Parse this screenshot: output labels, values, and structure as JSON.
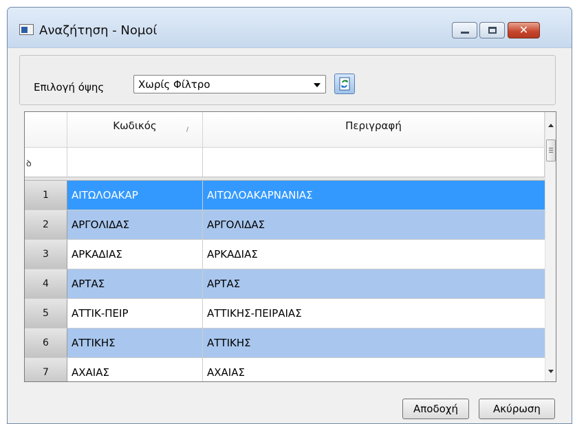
{
  "window": {
    "title": "Αναζήτηση - Νομοί",
    "minimize_label": "",
    "maximize_label": "",
    "close_label": "✕"
  },
  "filter": {
    "label": "Επιλογή όψης",
    "selected_view": "Χωρίς Φίλτρο"
  },
  "grid": {
    "columns": [
      "Κωδικός",
      "Περιγραφή"
    ],
    "sort_indicator": "/",
    "filter_icon": "ꝺ",
    "rows": [
      {
        "num": "1",
        "code": "ΑΙΤΩΛΟΑΚΑΡ",
        "desc": "ΑΙΤΩΛΟΑΚΑΡΝΑΝΙΑΣ",
        "state": "selected"
      },
      {
        "num": "2",
        "code": "ΑΡΓΟΛΙΔΑΣ",
        "desc": "ΑΡΓΟΛΙΔΑΣ",
        "state": "alt"
      },
      {
        "num": "3",
        "code": "ΑΡΚΑΔΙΑΣ",
        "desc": "ΑΡΚΑΔΙΑΣ",
        "state": "normal"
      },
      {
        "num": "4",
        "code": "ΑΡΤΑΣ",
        "desc": "ΑΡΤΑΣ",
        "state": "alt"
      },
      {
        "num": "5",
        "code": "ΑΤΤΙΚ-ΠΕΙΡ",
        "desc": "ΑΤΤΙΚΗΣ-ΠΕΙΡΑΙΑΣ",
        "state": "normal"
      },
      {
        "num": "6",
        "code": "ΑΤΤΙΚΗΣ",
        "desc": "ΑΤΤΙΚΗΣ",
        "state": "alt"
      },
      {
        "num": "7",
        "code": "ΑΧΑΙΑΣ",
        "desc": "ΑΧΑΙΑΣ",
        "state": "normal"
      }
    ]
  },
  "buttons": {
    "accept": "Αποδοχή",
    "cancel": "Ακύρωση"
  },
  "colors": {
    "selected_row": "#3399ff",
    "alt_row": "#a9c7ee",
    "normal_row": "#ffffff"
  }
}
